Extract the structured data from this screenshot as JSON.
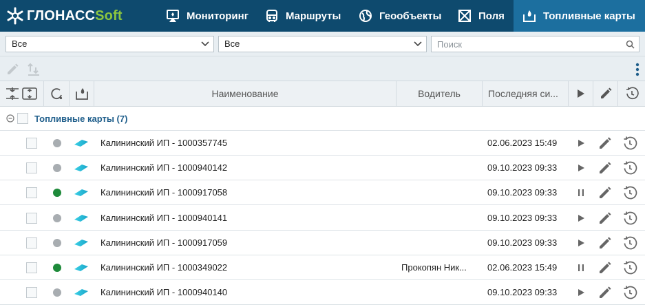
{
  "app": {
    "logo_main": "ГЛОНАСС",
    "logo_soft": "Soft"
  },
  "nav": {
    "items": [
      {
        "label": "Мониторинг",
        "icon": "monitor-icon"
      },
      {
        "label": "Маршруты",
        "icon": "bus-icon"
      },
      {
        "label": "Геообъекты",
        "icon": "globe-icon"
      },
      {
        "label": "Поля",
        "icon": "field-icon"
      },
      {
        "label": "Топливные карты",
        "icon": "fuel-card-icon",
        "active": true
      }
    ]
  },
  "filters": {
    "select1_value": "Все",
    "select2_value": "Все",
    "search_placeholder": "Поиск"
  },
  "table": {
    "columns": {
      "name": "Наименование",
      "driver": "Водитель",
      "last_signal": "Последняя си..."
    },
    "group": {
      "title": "Топливные карты (7)"
    },
    "rows": [
      {
        "name": "Калининский ИП - 1000357745",
        "driver": "",
        "date": "02.06.2023 15:49",
        "status": "grey",
        "state": "play"
      },
      {
        "name": "Калининский ИП - 1000940142",
        "driver": "",
        "date": "09.10.2023 09:33",
        "status": "grey",
        "state": "play"
      },
      {
        "name": "Калининский ИП - 1000917058",
        "driver": "",
        "date": "09.10.2023 09:33",
        "status": "green",
        "state": "pause"
      },
      {
        "name": "Калининский ИП - 1000940141",
        "driver": "",
        "date": "09.10.2023 09:33",
        "status": "grey",
        "state": "play"
      },
      {
        "name": "Калининский ИП - 1000917059",
        "driver": "",
        "date": "09.10.2023 09:33",
        "status": "grey",
        "state": "play"
      },
      {
        "name": "Калининский ИП - 1000349022",
        "driver": "Прокопян Ник...",
        "date": "02.06.2023 15:49",
        "status": "green",
        "state": "pause"
      },
      {
        "name": "Калининский ИП - 1000940140",
        "driver": "",
        "date": "09.10.2023 09:33",
        "status": "grey",
        "state": "play"
      }
    ]
  },
  "colors": {
    "topbar": "#0e4a6e",
    "active_tab": "#1c6f9f",
    "status_green": "#1e8a3a",
    "status_grey": "#a8adb1",
    "group_title": "#1f5e8b"
  }
}
